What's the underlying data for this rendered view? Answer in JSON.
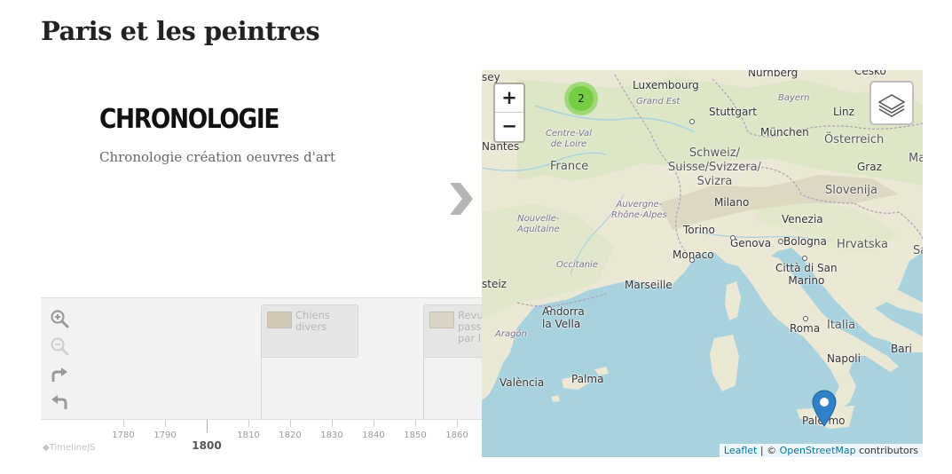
{
  "page": {
    "title": "Paris et les peintres"
  },
  "timeline": {
    "slide": {
      "title": "CHRONOLOGIE",
      "subtitle": "Chronologie création oeuvres d'art"
    },
    "brand": "TimelineJS",
    "markers": [
      {
        "text": "Chiens\ndivers"
      },
      {
        "text": "Revue\npassé\npar l"
      }
    ],
    "axis": {
      "minor_ticks": [
        "1780",
        "1790",
        "1810",
        "1820",
        "1830",
        "1840",
        "1850",
        "1860"
      ],
      "major_tick": "1800"
    },
    "icons": [
      "zoom-in-icon",
      "zoom-out-icon",
      "redo-icon",
      "back-icon"
    ]
  },
  "map": {
    "zoom_in": "+",
    "zoom_out": "−",
    "cluster_count": "2",
    "colors": {
      "sea": "#a9d2df",
      "land": "#ece8d6",
      "green": "#cfe2b5",
      "cluster": "#6ecc39",
      "pin": "#2e81c8"
    },
    "labels": {
      "nurnberg": "Nürnberg",
      "cesko": "Česko",
      "sey": "sey",
      "luxembourg": "Luxembourg",
      "grand_est": "Grand Est",
      "bayern": "Bayern",
      "stuttgart": "Stuttgart",
      "linz": "Linz",
      "munchen": "München",
      "osterreich": "Österreich",
      "centre_val": "Centre-Val\nde Loire",
      "nantes": "Nantes",
      "france": "France",
      "schweiz": "Schweiz/\nSuisse/Svizzera/\nSvizra",
      "graz": "Graz",
      "ma": "Ma",
      "slovenija": "Slovenija",
      "auvergne": "Auvergne-\nRhône-Alpes",
      "milano": "Milano",
      "nouvelle": "Nouvelle-\nAquitaine",
      "venezia": "Venezia",
      "torino": "Torino",
      "genova": "Genova",
      "bologna": "Bologna",
      "hrvatska": "Hrvatska",
      "monaco": "Monaco",
      "occitanie": "Occitanie",
      "sa": "Sa",
      "citta": "Città di San\nMarino",
      "marseille": "Marseille",
      "steiz": "steiz",
      "andorra": "Andorra\nla Vella",
      "aragon": "Aragón",
      "roma": "Roma",
      "italia": "Italia",
      "napoli": "Napoli",
      "bari": "Bari",
      "valencia": "València",
      "palma": "Palma",
      "palermo": "Palermo"
    },
    "attribution": {
      "leaflet": "Leaflet",
      "separator": " | © ",
      "osm": "OpenStreetMap",
      "suffix": " contributors"
    }
  }
}
